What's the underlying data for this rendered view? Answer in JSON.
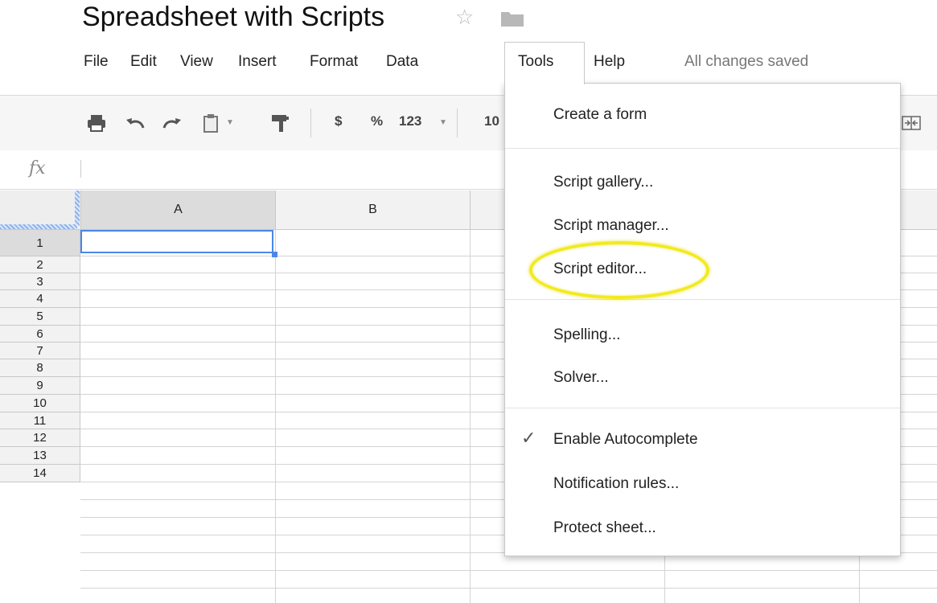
{
  "document": {
    "title": "Spreadsheet with Scripts"
  },
  "menu_bar": {
    "items": [
      "File",
      "Edit",
      "View",
      "Insert",
      "Format",
      "Data",
      "Tools",
      "Help"
    ],
    "active": "Tools",
    "save_status": "All changes saved"
  },
  "toolbar": {
    "currency_label": "$",
    "percent_label": "%",
    "number_format_label": "123",
    "font_size_label": "10",
    "icons": [
      "print-icon",
      "undo-icon",
      "redo-icon",
      "paste-icon",
      "paint-format-icon",
      "merge-cells-icon"
    ]
  },
  "formula_bar": {
    "fx_label": "fx",
    "value": ""
  },
  "grid": {
    "columns": [
      "A",
      "B"
    ],
    "rows": [
      "1",
      "2",
      "3",
      "4",
      "5",
      "6",
      "7",
      "8",
      "9",
      "10",
      "11",
      "12",
      "13",
      "14"
    ],
    "selected_cell": "A1"
  },
  "tools_menu": {
    "items": [
      {
        "label": "Create a form"
      },
      {
        "label": "Script gallery..."
      },
      {
        "label": "Script manager..."
      },
      {
        "label": "Script editor...",
        "highlighted": true
      },
      {
        "label": "Spelling..."
      },
      {
        "label": "Solver..."
      },
      {
        "label": "Enable Autocomplete",
        "checked": true
      },
      {
        "label": "Notification rules..."
      },
      {
        "label": "Protect sheet..."
      }
    ]
  },
  "colors": {
    "selection": "#4a86e8",
    "highlight_ring": "#f2ea1e"
  }
}
